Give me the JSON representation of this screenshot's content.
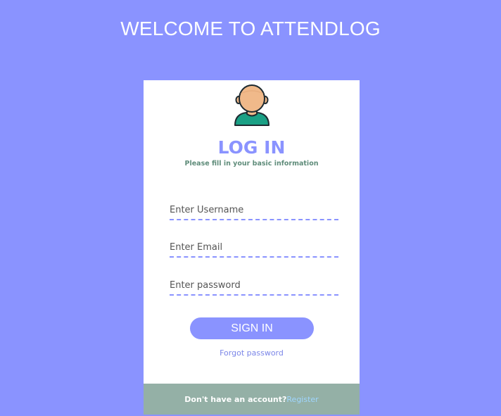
{
  "header": {
    "title": "WELCOME TO ATTENDLOG"
  },
  "card": {
    "avatar_icon": "user-avatar-icon",
    "title": "LOG IN",
    "subtitle": "Please fill in your basic information",
    "fields": {
      "username": {
        "value": "",
        "placeholder": "Enter Username"
      },
      "email": {
        "value": "",
        "placeholder": "Enter Email"
      },
      "password": {
        "value": "",
        "placeholder": "Enter password"
      }
    },
    "signin_label": "SIGN IN",
    "forgot_label": "Forgot password"
  },
  "footer": {
    "prompt": "Don't have an account?",
    "register_label": "Register"
  },
  "colors": {
    "background": "#8a93ff",
    "accent": "#8a93ff",
    "footer_bg": "#94b0a6",
    "subtitle": "#5f8c7a",
    "register_link": "#9fd6ff",
    "avatar_skin": "#f0b98a",
    "avatar_shirt": "#1aa085"
  }
}
